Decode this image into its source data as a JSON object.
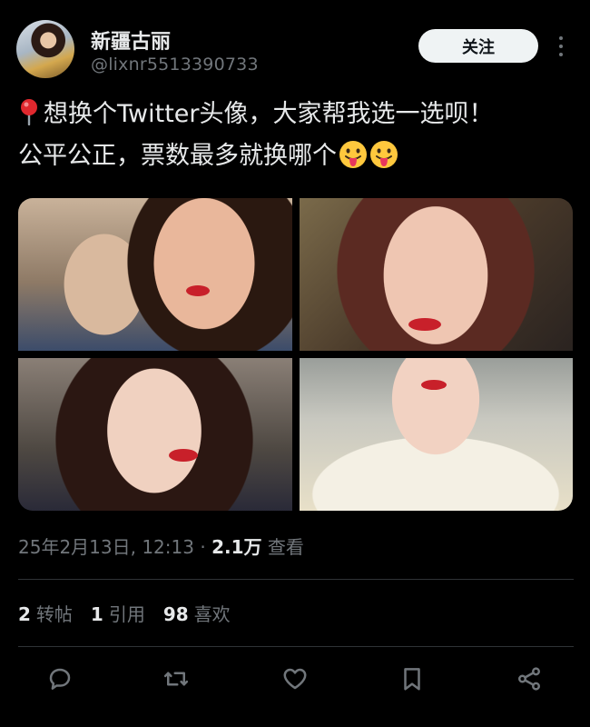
{
  "user": {
    "display_name": "新疆古丽",
    "handle": "@lixnr5513390733",
    "avatar_icon": "user-avatar"
  },
  "follow_button_label": "关注",
  "tweet": {
    "line1": "想换个Twitter头像，大家帮我选一选呗！",
    "line2": "公平公正，票数最多就换哪个",
    "leading_icon": "round-pushpin-emoji",
    "trailing_emojis": [
      "face-with-tongue-emoji",
      "face-with-tongue-emoji"
    ]
  },
  "media": {
    "photo_count": 4,
    "photos": [
      "photo-1",
      "photo-2",
      "photo-3",
      "photo-4"
    ]
  },
  "meta": {
    "datetime": "25年2月13日, 12:13",
    "separator": "·",
    "views_count": "2.1万",
    "views_label": "查看"
  },
  "stats": {
    "retweets_count": "2",
    "retweets_label": "转帖",
    "quotes_count": "1",
    "quotes_label": "引用",
    "likes_count": "98",
    "likes_label": "喜欢"
  },
  "actions": [
    "reply-icon",
    "retweet-icon",
    "like-icon",
    "bookmark-icon",
    "share-icon"
  ],
  "colors": {
    "background": "#000000",
    "text_primary": "#e7e9ea",
    "text_secondary": "#71767b",
    "divider": "#2f3336",
    "follow_button_bg": "#eff3f4"
  }
}
